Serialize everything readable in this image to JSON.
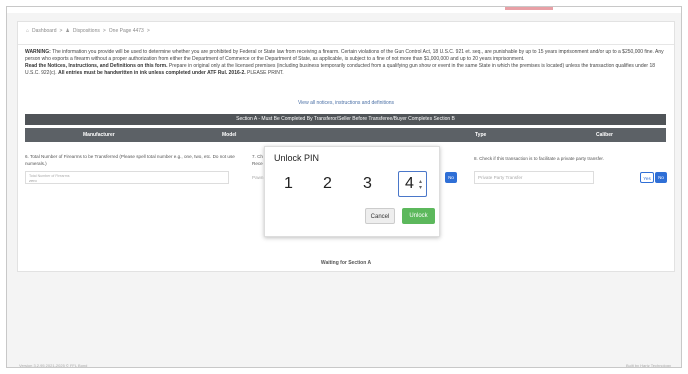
{
  "breadcrumb": {
    "items": [
      "Dashboard",
      "Dispositions",
      "One Page 4473"
    ],
    "sep": ">"
  },
  "notice": {
    "warning_label": "WARNING:",
    "warning_text": "The information you provide will be used to determine whether you are prohibited by Federal or State law from receiving a firearm. Certain violations of the Gun Control Act, 18 U.S.C. 921 et. seq., are punishable by up to 15 years imprisonment and/or up to a $250,000 fine. Any person who exports a firearm without a proper authorization from either the Department of Commerce or the Department of State, as applicable, is subject to a fine of not more than $1,000,000 and up to 20 years imprisonment.",
    "read_label": "Read the Notices, Instructions, and Definitions on this form.",
    "read_text": "Prepare in original only at the licensed premises (including business temporarily conducted from a qualifying gun show or event in the same State in which the premises is located) unless the transaction qualifies under 18 U.S.C. 922(c).",
    "ink_label": "All entries must be handwritten in ink unless completed under ATF Rul. 2016-2.",
    "print_text": "PLEASE PRINT."
  },
  "link_all_notices": "View all notices, instructions and definitions",
  "section_a": {
    "title": "Section A - Must Be Completed By Transferor/Seller Before Transferee/Buyer Completes Section B",
    "columns": [
      "Manufacturer",
      "Model",
      "Type",
      "Caliber"
    ]
  },
  "q6": {
    "label": "6. Total Number of Firearms to be Transferred (Please spell total number e.g., one, two, etc. Do not use numerals.)",
    "placeholder": "Total Number of Firearms",
    "value": "zero"
  },
  "q7": {
    "label": "7. Ch",
    "sublabel": "Rece",
    "field": "Pawn"
  },
  "q8": {
    "label": "8. Check if this transaction is to facilitate a private party transfer.",
    "field": "Private Party Transfer"
  },
  "toggle": {
    "yes": "Yes",
    "no": "No"
  },
  "waiting": "Waiting for Section A",
  "footer": {
    "left": "Version 3.2.95 2021-2025 © FFL Bond",
    "right": "Built by Hartz Technology"
  },
  "modal": {
    "title": "Unlock PIN",
    "digits": [
      "1",
      "2",
      "3",
      "4"
    ],
    "cancel": "Cancel",
    "unlock": "Unlock"
  },
  "colors": {
    "section_bar": "#505458",
    "header_bar": "#5c6166",
    "primary": "#2f6fd6",
    "success": "#5cb85c"
  }
}
